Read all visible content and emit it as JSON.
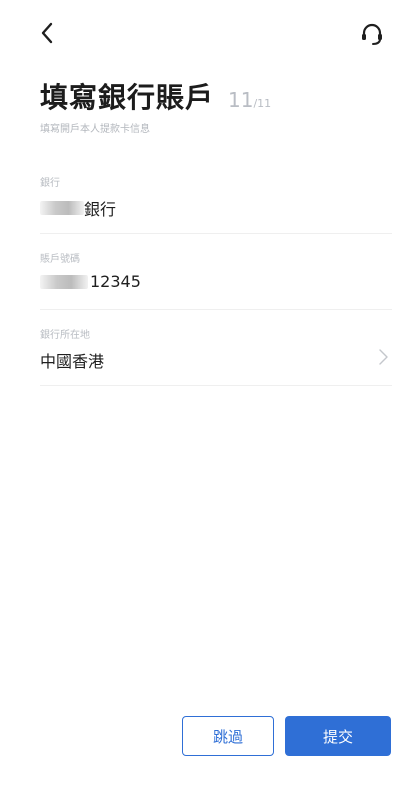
{
  "header": {
    "back_icon": "chevron-left-icon",
    "support_icon": "headset-icon"
  },
  "title": {
    "text": "填寫銀行賬戶",
    "step_current": "11",
    "step_total": "/11",
    "subtitle": "填寫開戶本人提款卡信息"
  },
  "fields": [
    {
      "label": "銀行",
      "value": "銀行",
      "redacted": true
    },
    {
      "label": "賬戶號碼",
      "value": "12345",
      "redacted": true
    },
    {
      "label": "銀行所在地",
      "value": "中國香港",
      "has_chevron": true
    }
  ],
  "actions": {
    "skip_label": "跳過",
    "submit_label": "提交"
  },
  "colors": {
    "accent": "#2f6fd6",
    "title": "#1c1c1c",
    "muted": "#b8bcc2",
    "divider": "#efefef"
  }
}
